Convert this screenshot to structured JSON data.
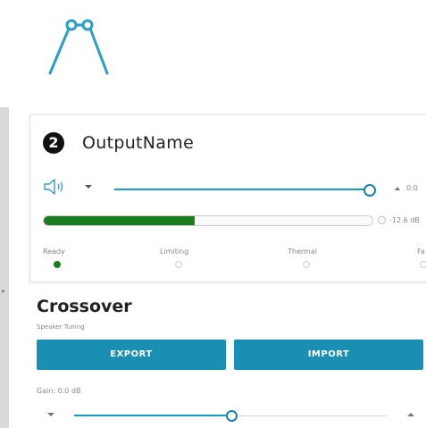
{
  "output": {
    "number": "2",
    "name": "OutputName",
    "volume_value": "0.0",
    "meter_value": "-12.6 dB",
    "meter_level": 0.46,
    "status": [
      {
        "label": "Ready",
        "active": true
      },
      {
        "label": "Limiting",
        "active": false
      },
      {
        "label": "Thermal",
        "active": false
      },
      {
        "label": "Fa",
        "active": false
      }
    ]
  },
  "crossover": {
    "title": "Crossover",
    "subtitle": "Speaker Tuning",
    "export_label": "EXPORT",
    "import_label": "IMPORT",
    "gain_label": "Gain: 0.0 dB"
  },
  "colors": {
    "accent": "#1a8fb3",
    "meter_green": "#1b7d20"
  },
  "icons": {
    "logo": "speaker-stand-logo-icon",
    "speaker": "speaker-volume-icon",
    "caret_down": "caret-down-icon",
    "caret_up": "caret-up-icon"
  }
}
